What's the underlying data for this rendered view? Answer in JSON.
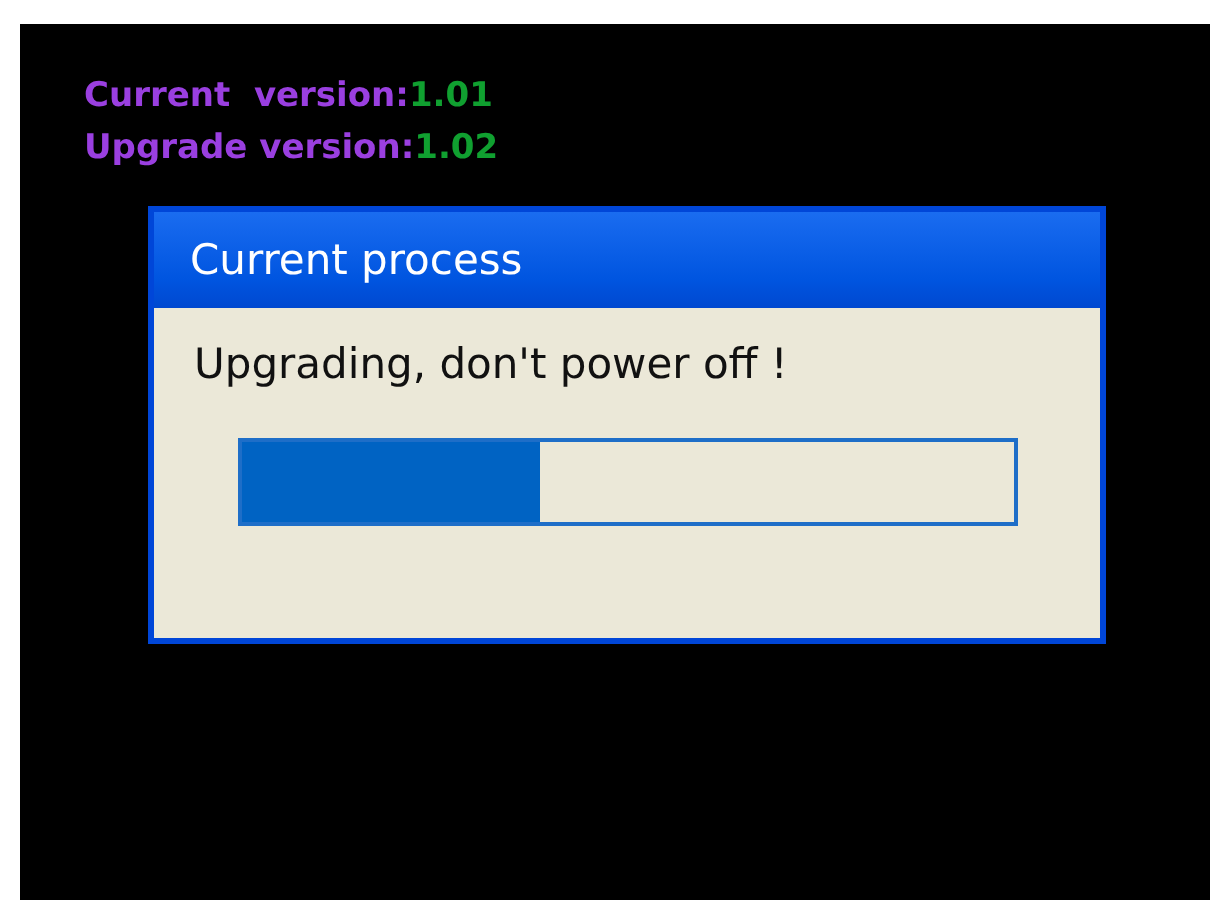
{
  "versions": [
    {
      "label": "Current  version:",
      "value": "1.01"
    },
    {
      "label": "Upgrade version:",
      "value": "1.02"
    }
  ],
  "dialog": {
    "title": "Current process",
    "message": "Upgrading, don't power off !",
    "progress": {
      "level": 0.385
    }
  }
}
